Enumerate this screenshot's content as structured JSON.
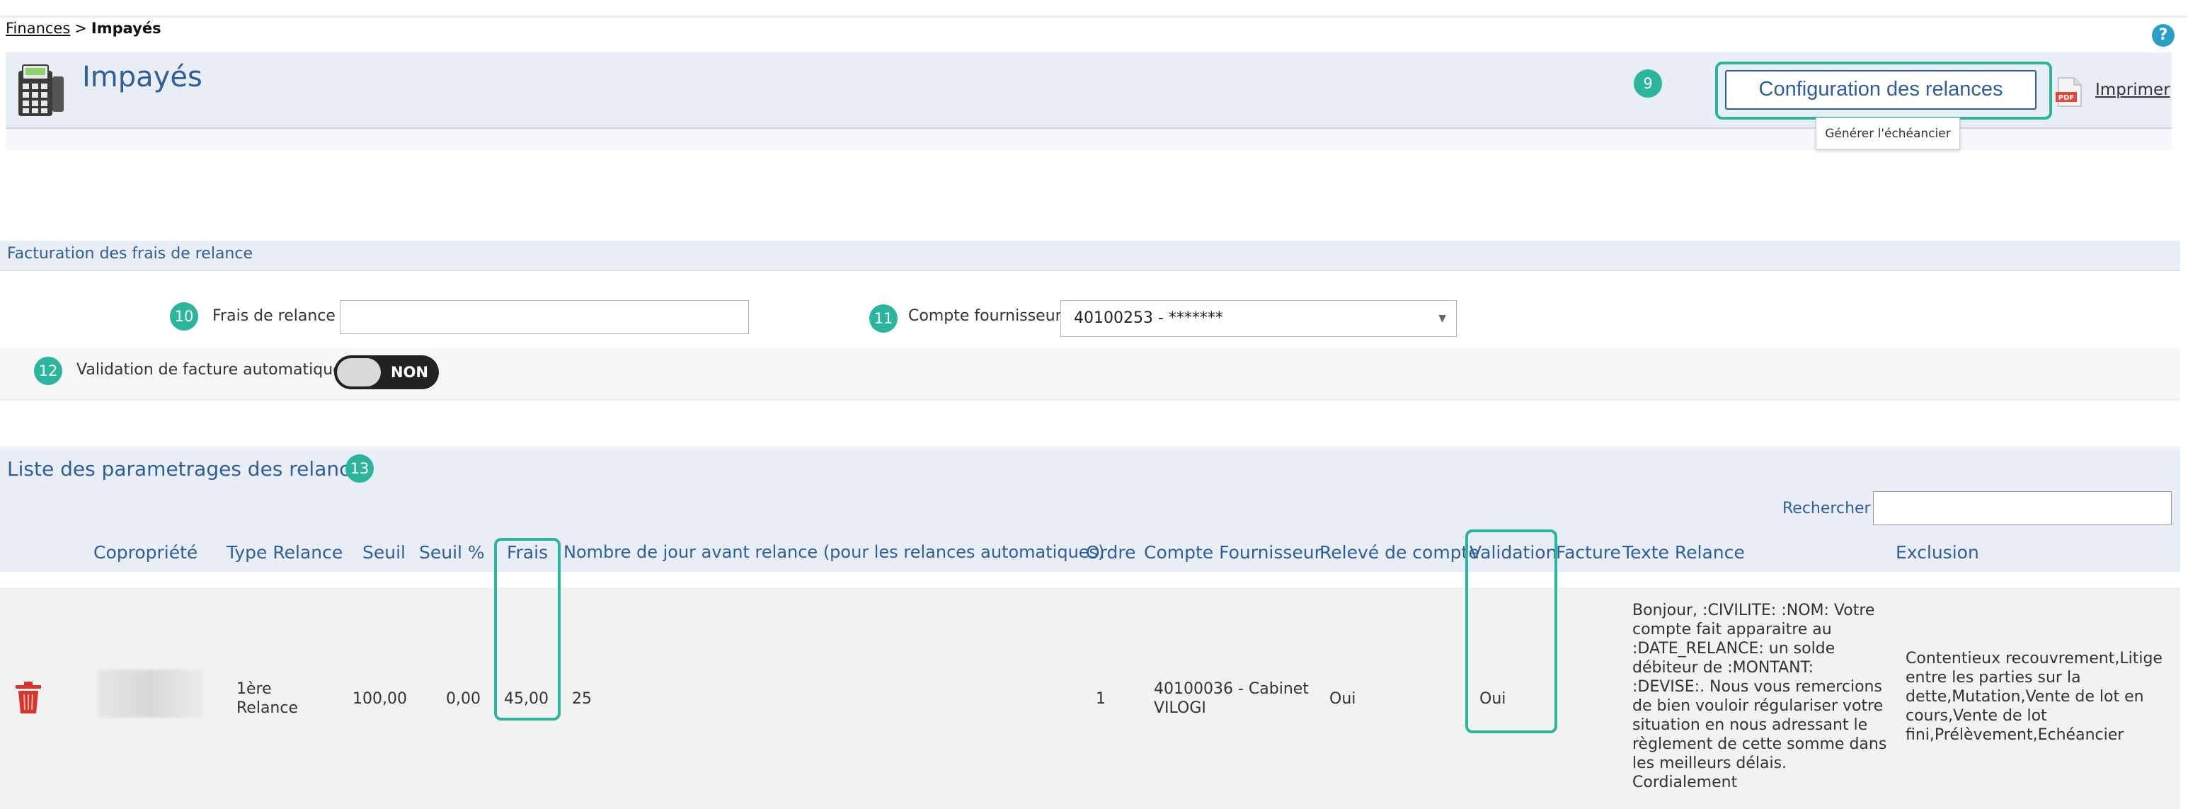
{
  "breadcrumb": {
    "parent": "Finances",
    "separator": ">",
    "current": "Impayés"
  },
  "help_label": "?",
  "header": {
    "title": "Impayés",
    "config_button": "Configuration des relances",
    "tooltip": "Générer l'échéancier",
    "print_label": "Imprimer"
  },
  "badges": {
    "b9": "9",
    "b10": "10",
    "b11": "11",
    "b12": "12",
    "b13": "13"
  },
  "billing_section": {
    "title": "Facturation des frais de relance",
    "fee_label": "Frais de relance",
    "fee_value": "",
    "supplier_label": "Compte fournisseur",
    "supplier_value": "40100253 - *******",
    "auto_validation_label": "Validation de facture automatique",
    "toggle_state": "NON"
  },
  "list_section": {
    "title": "Liste des parametrages des relances",
    "search_label": "Rechercher",
    "search_value": "",
    "columns": {
      "copro": "Copropriété",
      "type": "Type Relance",
      "seuil": "Seuil",
      "seuil_pct": "Seuil %",
      "frais": "Frais",
      "nb_jours": "Nombre de jour avant relance (pour les relances automatiques)",
      "ordre": "Ordre",
      "compte": "Compte Fournisseur",
      "releve": "Relevé de compte",
      "validation": "Validation",
      "facture": "Facture",
      "texte": "Texte Relance",
      "exclusion": "Exclusion"
    },
    "rows": [
      {
        "type_line1": "1ère",
        "type_line2": "Relance",
        "seuil": "100,00",
        "seuil_pct": "0,00",
        "frais": "45,00",
        "nb_jours": "25",
        "ordre": "1",
        "compte_line1": "40100036 - Cabinet",
        "compte_line2": "VILOGI",
        "releve": "Oui",
        "validation": "Oui",
        "texte_lines": [
          "Bonjour, :CIVILITE: :NOM: Votre",
          "compte fait apparaitre au",
          ":DATE_RELANCE: un solde",
          "débiteur de :MONTANT:",
          ":DEVISE:. Nous vous remercions",
          "de bien vouloir régulariser votre",
          "situation en nous adressant le",
          "règlement de cette somme dans",
          "les meilleurs délais.",
          "Cordialement"
        ],
        "exclusion_lines": [
          "Contentieux recouvrement,Litige",
          "entre les parties sur la",
          "dette,Mutation,Vente de lot en",
          "cours,Vente de lot",
          "fini,Prélèvement,Echéancier"
        ]
      }
    ]
  },
  "colors": {
    "accent": "#2f5f98",
    "highlight": "#2bb59c",
    "trash": "#d9342b"
  },
  "icons": [
    "help-icon",
    "calculator-icon",
    "pdf-icon",
    "trash-icon",
    "dropdown-caret-icon"
  ]
}
